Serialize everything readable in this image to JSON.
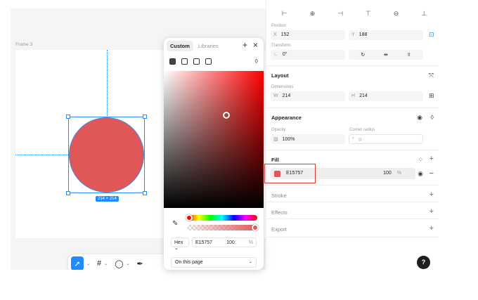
{
  "canvas": {
    "frame_label": "Frame 3",
    "size_badge": "214 × 214",
    "shape_fill": "#E15757"
  },
  "toolbar": {
    "tools": [
      "move-tool",
      "frame-tool",
      "ellipse-tool",
      "pen-tool"
    ]
  },
  "picker": {
    "tabs": [
      "Custom",
      "Libraries"
    ],
    "active_tab": "Custom",
    "format": "Hex",
    "hex": "E15757",
    "opacity": "100",
    "opacity_unit": "%",
    "source": "On this page",
    "swatches": [
      "#FFFFFF",
      "#D9D9D9",
      "#FF0000",
      "#F0F0F0",
      "#000000"
    ]
  },
  "panel": {
    "position_label": "Position",
    "x_key": "X",
    "x": "152",
    "y_key": "Y",
    "y": "188",
    "transform_label": "Transform",
    "rotation": "0°",
    "layout_title": "Layout",
    "dimensions_label": "Dimensions",
    "w_key": "W",
    "w": "214",
    "h_key": "H",
    "h": "214",
    "appearance_title": "Appearance",
    "opacity_label": "Opacity",
    "opacity": "100%",
    "radius_label": "Corner radius",
    "radius": "0",
    "fill_title": "Fill",
    "fill_hex": "E15757",
    "fill_opacity": "100",
    "fill_unit": "%",
    "stroke_title": "Stroke",
    "effects_title": "Effects",
    "export_title": "Export"
  },
  "help_label": "?"
}
